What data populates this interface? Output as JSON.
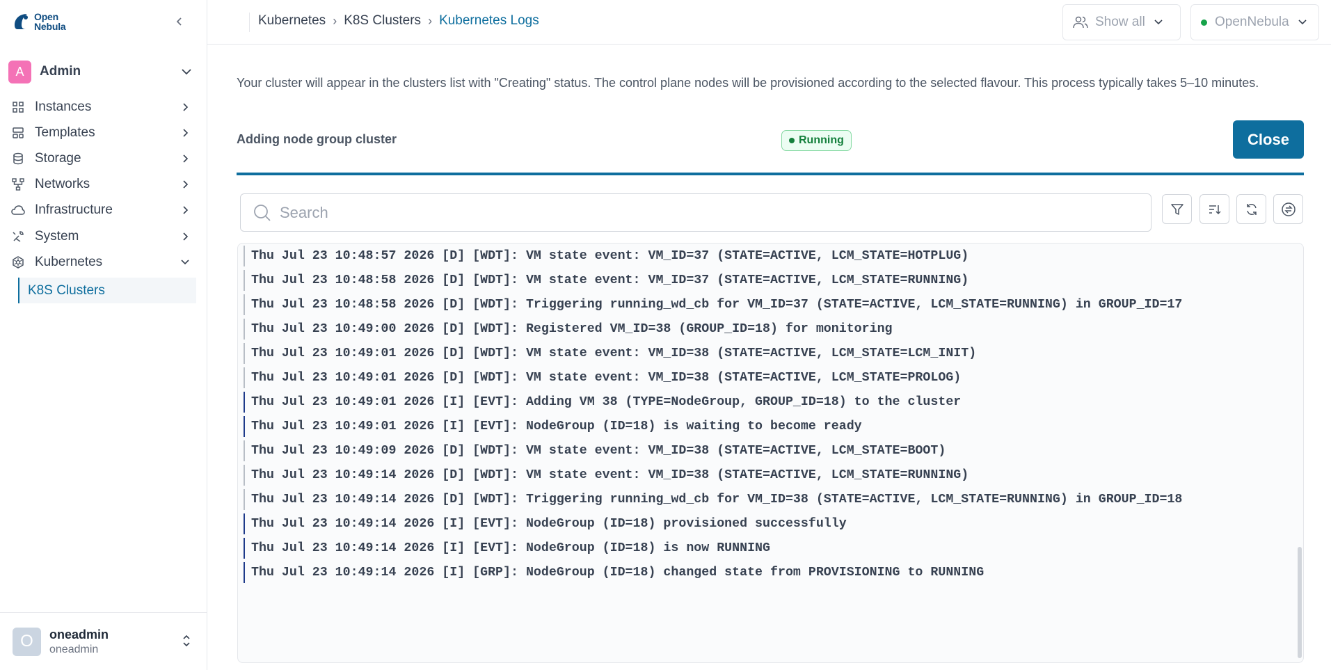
{
  "app": {
    "logo_line1": "Open",
    "logo_line2": "Nebula"
  },
  "sidebar": {
    "group": {
      "avatar": "A",
      "name": "Admin"
    },
    "items": [
      {
        "label": "Instances",
        "icon": "grid-icon"
      },
      {
        "label": "Templates",
        "icon": "template-icon"
      },
      {
        "label": "Storage",
        "icon": "database-icon"
      },
      {
        "label": "Networks",
        "icon": "network-icon"
      },
      {
        "label": "Infrastructure",
        "icon": "cloud-icon"
      },
      {
        "label": "System",
        "icon": "tools-icon"
      },
      {
        "label": "Kubernetes",
        "icon": "kubernetes-icon"
      }
    ],
    "sub_item": "K8S Clusters",
    "user": {
      "avatar": "O",
      "name": "oneadmin",
      "group": "oneadmin"
    }
  },
  "header": {
    "breadcrumb": [
      "Kubernetes",
      "K8S Clusters",
      "Kubernetes Logs"
    ],
    "view_filter": "Show all",
    "zone": "OpenNebula"
  },
  "main": {
    "info": "Your cluster will appear in the clusters list with \"Creating\" status. The control plane nodes will be provisioned according to the selected flavour. This process typically takes 5–10 minutes.",
    "task_title": "Adding node group cluster",
    "status": "Running",
    "close_label": "Close",
    "progress": 1.0,
    "search_placeholder": "Search"
  },
  "logs": [
    {
      "level": "D",
      "text": "Thu Jul 23 10:48:57 2026 [D] [WDT]: VM state event: VM_ID=37 (STATE=ACTIVE, LCM_STATE=HOTPLUG)"
    },
    {
      "level": "D",
      "text": "Thu Jul 23 10:48:58 2026 [D] [WDT]: VM state event: VM_ID=37 (STATE=ACTIVE, LCM_STATE=RUNNING)"
    },
    {
      "level": "D",
      "text": "Thu Jul 23 10:48:58 2026 [D] [WDT]: Triggering running_wd_cb for VM_ID=37 (STATE=ACTIVE, LCM_STATE=RUNNING) in GROUP_ID=17"
    },
    {
      "level": "D",
      "text": "Thu Jul 23 10:49:00 2026 [D] [WDT]: Registered VM_ID=38 (GROUP_ID=18) for monitoring"
    },
    {
      "level": "D",
      "text": "Thu Jul 23 10:49:01 2026 [D] [WDT]: VM state event: VM_ID=38 (STATE=ACTIVE, LCM_STATE=LCM_INIT)"
    },
    {
      "level": "D",
      "text": "Thu Jul 23 10:49:01 2026 [D] [WDT]: VM state event: VM_ID=38 (STATE=ACTIVE, LCM_STATE=PROLOG)"
    },
    {
      "level": "I",
      "text": "Thu Jul 23 10:49:01 2026 [I] [EVT]: Adding VM 38 (TYPE=NodeGroup, GROUP_ID=18) to the cluster"
    },
    {
      "level": "I",
      "text": "Thu Jul 23 10:49:01 2026 [I] [EVT]: NodeGroup (ID=18) is waiting to become ready"
    },
    {
      "level": "D",
      "text": "Thu Jul 23 10:49:09 2026 [D] [WDT]: VM state event: VM_ID=38 (STATE=ACTIVE, LCM_STATE=BOOT)"
    },
    {
      "level": "D",
      "text": "Thu Jul 23 10:49:14 2026 [D] [WDT]: VM state event: VM_ID=38 (STATE=ACTIVE, LCM_STATE=RUNNING)"
    },
    {
      "level": "D",
      "text": "Thu Jul 23 10:49:14 2026 [D] [WDT]: Triggering running_wd_cb for VM_ID=38 (STATE=ACTIVE, LCM_STATE=RUNNING) in GROUP_ID=18"
    },
    {
      "level": "I",
      "text": "Thu Jul 23 10:49:14 2026 [I] [EVT]: NodeGroup (ID=18) provisioned successfully"
    },
    {
      "level": "I",
      "text": "Thu Jul 23 10:49:14 2026 [I] [EVT]: NodeGroup (ID=18) is now RUNNING"
    },
    {
      "level": "I",
      "text": "Thu Jul 23 10:49:14 2026 [I] [GRP]: NodeGroup (ID=18) changed state from PROVISIONING to RUNNING"
    }
  ],
  "colors": {
    "accent": "#0e6e9e",
    "running_green": "#15803d",
    "avatar_pink": "#f472b6"
  }
}
